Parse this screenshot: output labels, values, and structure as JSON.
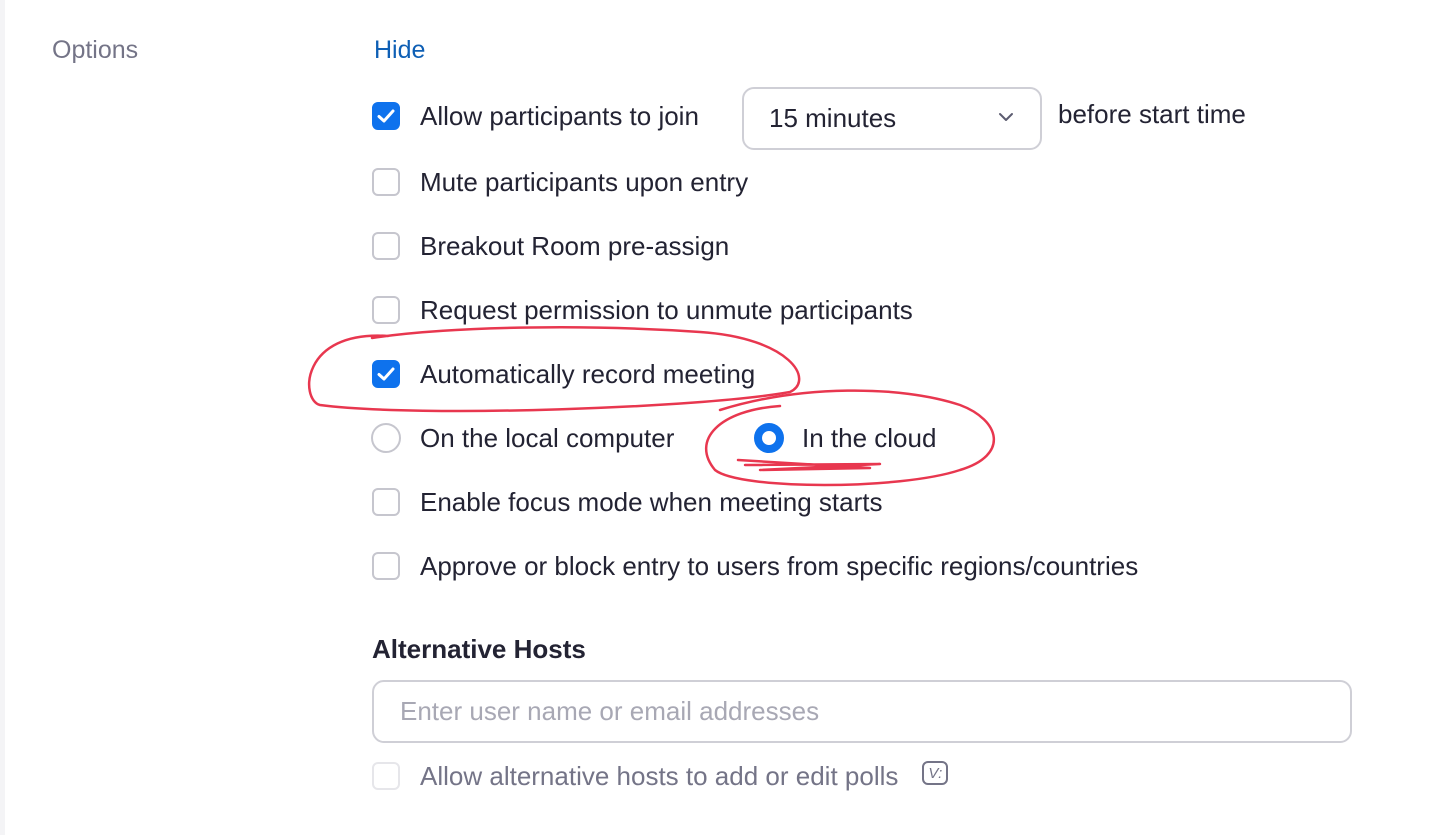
{
  "options": {
    "label": "Options",
    "hide_link": "Hide"
  },
  "join_before_host": {
    "label": "Allow participants to join",
    "checked": true,
    "select_value": "15 minutes",
    "suffix": "before start time"
  },
  "checkboxes": [
    {
      "label": "Mute participants upon entry",
      "checked": false
    },
    {
      "label": "Breakout Room pre-assign",
      "checked": false
    },
    {
      "label": "Request permission to unmute participants",
      "checked": false
    },
    {
      "label": "Automatically record meeting",
      "checked": true
    }
  ],
  "recording_location": {
    "local_label": "On the local computer",
    "cloud_label": "In the cloud",
    "selected": "cloud"
  },
  "more_checkboxes": [
    {
      "label": "Enable focus mode when meeting starts",
      "checked": false
    },
    {
      "label": "Approve or block entry to users from specific regions/countries",
      "checked": false
    }
  ],
  "alternative_hosts": {
    "title": "Alternative Hosts",
    "placeholder": "Enter user name or email addresses",
    "polls_label": "Allow alternative hosts to add or edit polls",
    "polls_checked": false
  },
  "colors": {
    "accent": "#0e72ed",
    "link": "#0e5fb5",
    "annotation": "#e8374f"
  },
  "icons": [
    "checkmark-icon",
    "chevron-down-icon",
    "poll-icon"
  ]
}
